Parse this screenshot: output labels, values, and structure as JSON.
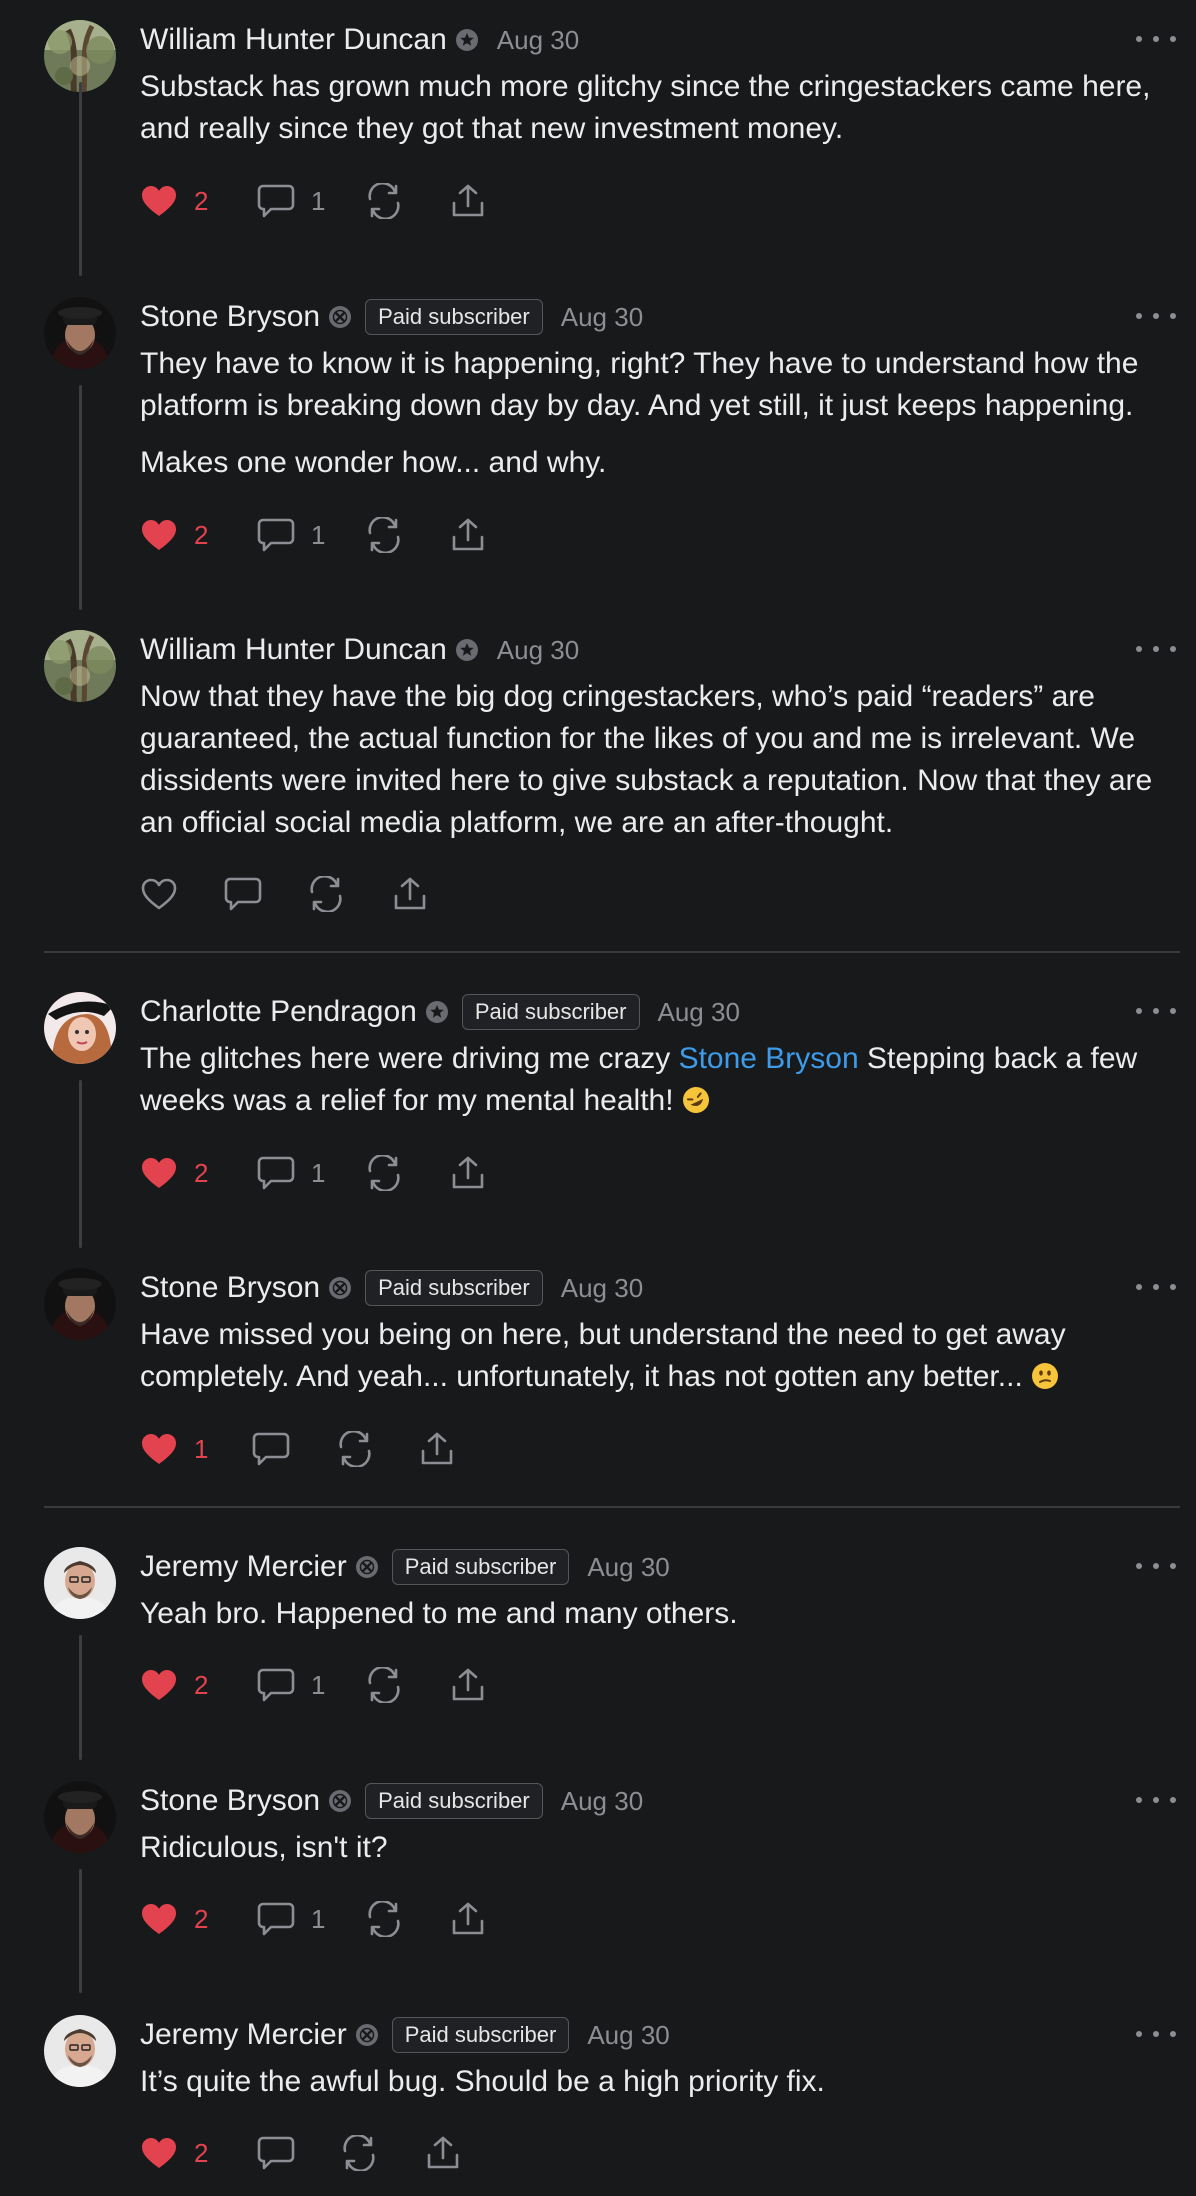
{
  "colors": {
    "background": "#18191b",
    "text": "#ececec",
    "muted": "#8d8e93",
    "like_red": "#e3434f",
    "mention_blue": "#3d9be9"
  },
  "comments": [
    {
      "author": "William Hunter Duncan",
      "badge_icon": "star-badge-icon",
      "paid": false,
      "date": "Aug 30",
      "text": [
        "Substack has grown much more glitchy since the cringestackers came here, and really since they got that new investment money."
      ],
      "likes": "2",
      "liked": true,
      "replies": "1"
    },
    {
      "author": "Stone Bryson",
      "badge_icon": "x-badge-icon",
      "paid": true,
      "paid_label": "Paid subscriber",
      "date": "Aug 30",
      "text": [
        "They have to know it is happening, right? They have to understand how the platform is breaking down day by day. And yet still, it just keeps happening.",
        "Makes one wonder how... and why."
      ],
      "likes": "2",
      "liked": true,
      "replies": "1"
    },
    {
      "author": "William Hunter Duncan",
      "badge_icon": "star-badge-icon",
      "paid": false,
      "date": "Aug 30",
      "text": [
        "Now that they have the big dog cringestackers, who’s paid “readers” are guaranteed, the actual function for the likes of you and me is irrelevant. We dissidents were invited here to give substack a reputation. Now that they are an official social media platform, we are an after-thought."
      ],
      "likes": "",
      "liked": false,
      "replies": ""
    },
    {
      "author": "Charlotte Pendragon",
      "badge_icon": "star-badge-icon",
      "paid": true,
      "paid_label": "Paid subscriber",
      "date": "Aug 30",
      "text_before": "The glitches here were driving me crazy ",
      "mention": "Stone Bryson",
      "text_after": " Stepping back a few weeks was a relief for my mental health! ",
      "emoji": "rofl-emoji",
      "likes": "2",
      "liked": true,
      "replies": "1"
    },
    {
      "author": "Stone Bryson",
      "badge_icon": "x-badge-icon",
      "paid": true,
      "paid_label": "Paid subscriber",
      "date": "Aug 30",
      "text_main": "Have missed you being on here, but understand the need to get away completely. And yeah... unfortunately, it has not gotten any better... ",
      "emoji": "confused-emoji",
      "likes": "1",
      "liked": true,
      "replies": ""
    },
    {
      "author": "Jeremy Mercier",
      "badge_icon": "x-badge-icon",
      "paid": true,
      "paid_label": "Paid subscriber",
      "date": "Aug 30",
      "text": [
        "Yeah bro. Happened to me and many others."
      ],
      "likes": "2",
      "liked": true,
      "replies": "1"
    },
    {
      "author": "Stone Bryson",
      "badge_icon": "x-badge-icon",
      "paid": true,
      "paid_label": "Paid subscriber",
      "date": "Aug 30",
      "text": [
        "Ridiculous, isn't it?"
      ],
      "likes": "2",
      "liked": true,
      "replies": "1"
    },
    {
      "author": "Jeremy Mercier",
      "badge_icon": "x-badge-icon",
      "paid": true,
      "paid_label": "Paid subscriber",
      "date": "Aug 30",
      "text": [
        "It’s quite the awful bug. Should be a high priority fix."
      ],
      "likes": "2",
      "liked": true,
      "replies": ""
    }
  ]
}
